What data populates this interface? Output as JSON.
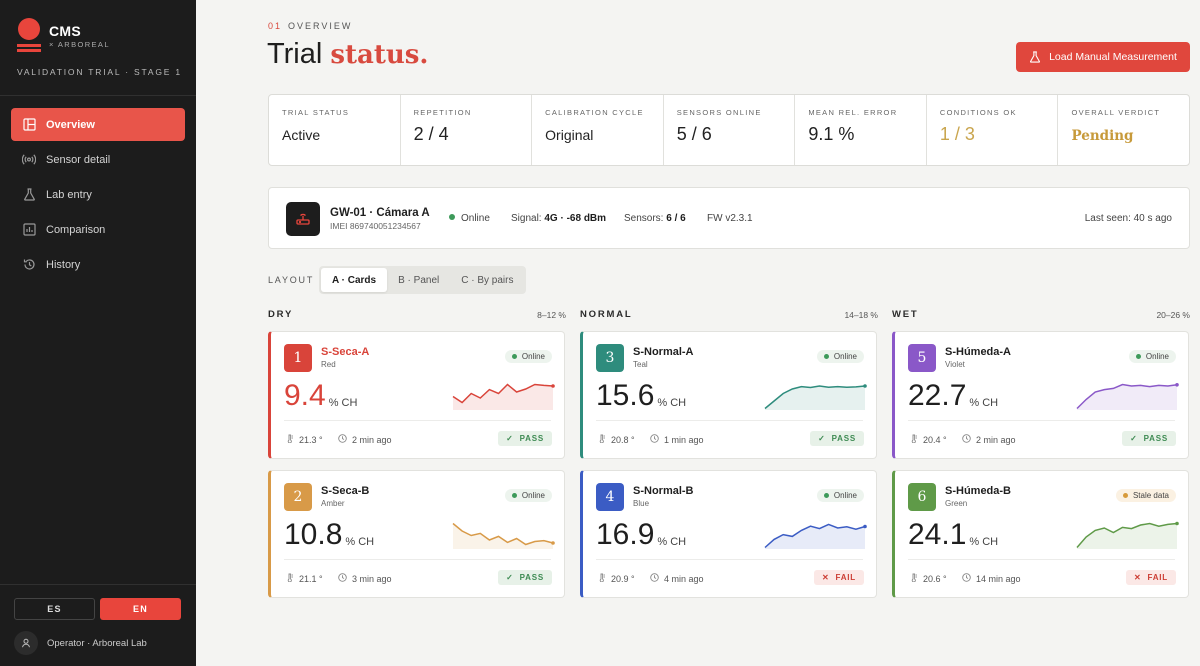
{
  "brand": {
    "name": "CMS",
    "sub": "× ARBOREAL",
    "trial": "VALIDATION TRIAL · STAGE 1"
  },
  "nav": [
    {
      "label": "Overview",
      "icon": "layout-icon",
      "active": true
    },
    {
      "label": "Sensor detail",
      "icon": "broadcast-icon",
      "active": false
    },
    {
      "label": "Lab entry",
      "icon": "flask-icon",
      "active": false
    },
    {
      "label": "Comparison",
      "icon": "bar-chart-icon",
      "active": false
    },
    {
      "label": "History",
      "icon": "history-icon",
      "active": false
    }
  ],
  "lang": {
    "es": "ES",
    "en": "EN",
    "selected": "EN"
  },
  "operator": "Operator · Arboreal Lab",
  "header": {
    "eyebrow_num": "01",
    "eyebrow": "OVERVIEW",
    "title_plain": "Trial",
    "title_accent": "status.",
    "load_button": "Load Manual Measurement"
  },
  "stats": [
    {
      "label": "TRIAL STATUS",
      "value": "Active"
    },
    {
      "label": "REPETITION",
      "value": "2 / 4"
    },
    {
      "label": "CALIBRATION CYCLE",
      "value": "Original"
    },
    {
      "label": "SENSORS ONLINE",
      "value": "5 / 6"
    },
    {
      "label": "MEAN REL. ERROR",
      "value": "9.1 %"
    },
    {
      "label": "CONDITIONS OK",
      "value": "1 / 3"
    },
    {
      "label": "OVERALL VERDICT",
      "value": "Pending"
    }
  ],
  "gateway": {
    "name": "GW-01 · Cámara A",
    "imei": "IMEI 869740051234567",
    "status": "Online",
    "signal_label": "Signal:",
    "signal_value": "4G · -68 dBm",
    "sensors_label": "Sensors:",
    "sensors_value": "6 / 6",
    "firmware": "FW v2.3.1",
    "last_seen": "Last seen: 40 s ago"
  },
  "layout": {
    "label": "LAYOUT",
    "options": [
      "A · Cards",
      "B · Panel",
      "C · By pairs"
    ],
    "selected": "A · Cards"
  },
  "groups": [
    {
      "name": "DRY",
      "range": "8–12 %"
    },
    {
      "name": "NORMAL",
      "range": "14–18 %"
    },
    {
      "name": "WET",
      "range": "20–26 %"
    }
  ],
  "sensors": [
    {
      "num": "1",
      "name": "S-Seca-A",
      "color_name": "Red",
      "color": "#d9443a",
      "status": "Online",
      "value": "9.4",
      "unit": "% CH",
      "temp": "21.3 °",
      "time": "2 min ago",
      "verdict": "PASS",
      "spark": [
        0.45,
        0.25,
        0.55,
        0.4,
        0.68,
        0.55,
        0.85,
        0.6,
        0.7,
        0.85,
        0.82,
        0.8
      ]
    },
    {
      "num": "2",
      "name": "S-Seca-B",
      "color_name": "Amber",
      "color": "#d89a48",
      "status": "Online",
      "value": "10.8",
      "unit": "% CH",
      "temp": "21.1 °",
      "time": "3 min ago",
      "verdict": "PASS",
      "spark": [
        0.85,
        0.6,
        0.45,
        0.52,
        0.3,
        0.42,
        0.22,
        0.35,
        0.15,
        0.25,
        0.28,
        0.2
      ]
    },
    {
      "num": "3",
      "name": "S-Normal-A",
      "color_name": "Teal",
      "color": "#2e8c7d",
      "status": "Online",
      "value": "15.6",
      "unit": "% CH",
      "temp": "20.8 °",
      "time": "1 min ago",
      "verdict": "PASS",
      "spark": [
        0.05,
        0.3,
        0.55,
        0.7,
        0.78,
        0.75,
        0.8,
        0.76,
        0.78,
        0.76,
        0.77,
        0.8
      ]
    },
    {
      "num": "4",
      "name": "S-Normal-B",
      "color_name": "Blue",
      "color": "#3b5cc4",
      "status": "Online",
      "value": "16.9",
      "unit": "% CH",
      "temp": "20.9 °",
      "time": "4 min ago",
      "verdict": "FAIL",
      "spark": [
        0.05,
        0.32,
        0.48,
        0.42,
        0.62,
        0.76,
        0.68,
        0.82,
        0.7,
        0.74,
        0.66,
        0.75
      ]
    },
    {
      "num": "5",
      "name": "S-Húmeda-A",
      "color_name": "Violet",
      "color": "#8a58c8",
      "status": "Online",
      "value": "22.7",
      "unit": "% CH",
      "temp": "20.4 °",
      "time": "2 min ago",
      "verdict": "PASS",
      "spark": [
        0.05,
        0.35,
        0.6,
        0.68,
        0.72,
        0.85,
        0.8,
        0.82,
        0.78,
        0.82,
        0.8,
        0.84
      ]
    },
    {
      "num": "6",
      "name": "S-Húmeda-B",
      "color_name": "Green",
      "color": "#5f9a48",
      "status": "Stale data",
      "value": "24.1",
      "unit": "% CH",
      "temp": "20.6 °",
      "time": "14 min ago",
      "verdict": "FAIL",
      "spark": [
        0.05,
        0.4,
        0.62,
        0.7,
        0.55,
        0.72,
        0.68,
        0.8,
        0.85,
        0.76,
        0.82,
        0.85
      ]
    }
  ]
}
